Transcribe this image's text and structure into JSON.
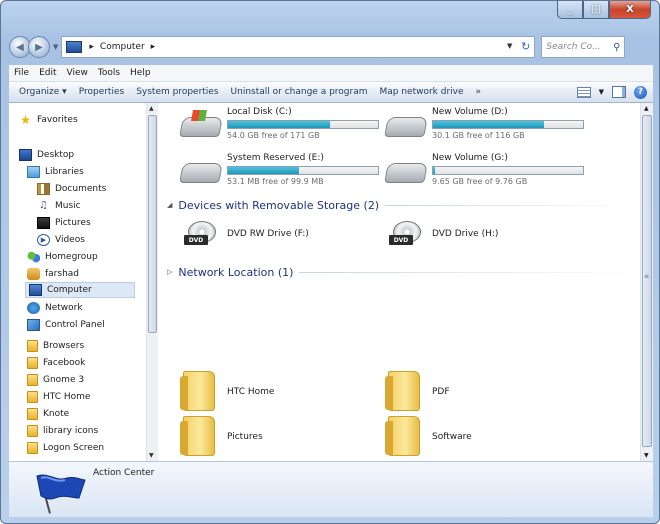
{
  "window": {
    "min_glyph": "_",
    "max_glyph": "□",
    "close_glyph": "X"
  },
  "address": {
    "location": "Computer",
    "search_placeholder": "Search Co..."
  },
  "menu": [
    "File",
    "Edit",
    "View",
    "Tools",
    "Help"
  ],
  "commands": {
    "organize": "Organize ▾",
    "properties": "Properties",
    "system_properties": "System properties",
    "uninstall": "Uninstall or change a program",
    "map_drive": "Map network drive",
    "more": "»"
  },
  "nav": {
    "favorites": "Favorites",
    "desktop": "Desktop",
    "libraries": "Libraries",
    "documents": "Documents",
    "music": "Music",
    "pictures": "Pictures",
    "videos": "Videos",
    "homegroup": "Homegroup",
    "farshad": "farshad",
    "computer": "Computer",
    "network": "Network",
    "control_panel": "Control Panel",
    "folders": [
      "Browsers",
      "Facebook",
      "Gnome 3",
      "HTC Home",
      "Knote",
      "library icons",
      "Logon Screen"
    ]
  },
  "drives": {
    "c": {
      "name": "Local Disk (C:)",
      "free": "54.0 GB free of 171 GB",
      "used_pct": 68
    },
    "d": {
      "name": "New Volume (D:)",
      "free": "30.1 GB free of 116 GB",
      "used_pct": 74
    },
    "e": {
      "name": "System Reserved (E:)",
      "free": "53.1 MB free of 99.9 MB",
      "used_pct": 47
    },
    "g": {
      "name": "New Volume (G:)",
      "free": "9.65 GB free of 9.76 GB",
      "used_pct": 1
    }
  },
  "groups": {
    "removable": "Devices with Removable Storage (2)",
    "network": "Network Location (1)"
  },
  "removable": {
    "f": "DVD RW Drive (F:)",
    "h": "DVD Drive (H:)",
    "tag": "DVD"
  },
  "folders": {
    "htc_home": "HTC Home",
    "pdf": "PDF",
    "pictures": "Pictures",
    "software": "Software"
  },
  "details": {
    "title": "Action Center"
  }
}
